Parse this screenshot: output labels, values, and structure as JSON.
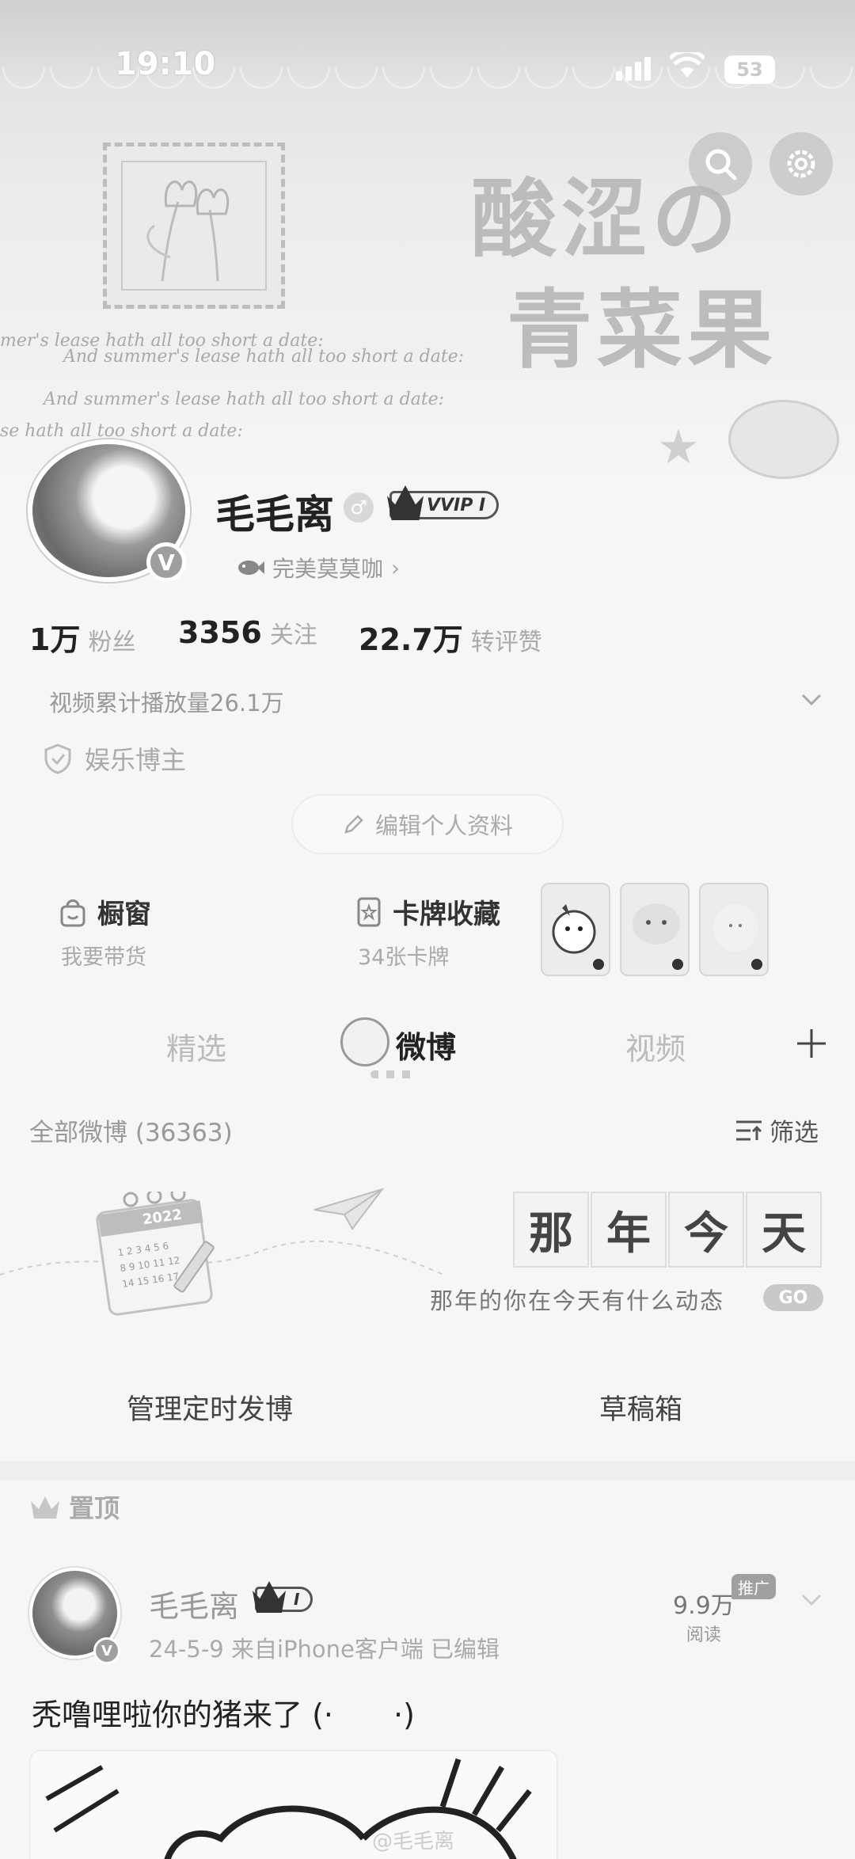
{
  "status_bar": {
    "time": "19:10",
    "battery": "53"
  },
  "banner": {
    "title_line1": "酸涩の",
    "title_line2": "青菜果",
    "script_line1": "mer's lease hath all too short a date:",
    "script_line2": "And summer's lease hath all too short a date:",
    "script_line3": "And summer's lease hath all too short a date:",
    "script_line4": "se hath all too short a date:"
  },
  "profile": {
    "username": "毛毛离",
    "gender": "♂",
    "vip_label": "VVIP Ⅰ",
    "verified_mark": "V",
    "fan_club": "完美莫莫咖",
    "stats": [
      {
        "value": "1万",
        "label": "粉丝"
      },
      {
        "value": "3356",
        "label": "关注"
      },
      {
        "value": "22.7万",
        "label": "转评赞"
      }
    ],
    "play_count": "视频累计播放量26.1万",
    "tag": "娱乐博主",
    "edit_button": "编辑个人资料"
  },
  "features": {
    "shop": {
      "title": "橱窗",
      "subtitle": "我要带货"
    },
    "cards": {
      "title": "卡牌收藏",
      "subtitle": "34张卡牌"
    }
  },
  "tabs": [
    {
      "label": "精选"
    },
    {
      "label": "微博"
    },
    {
      "label": "视频"
    }
  ],
  "feed": {
    "all_weibo": "全部微博 (36363)",
    "filter": "筛选"
  },
  "memories": {
    "chars": [
      "那",
      "年",
      "今",
      "天"
    ],
    "subtitle": "那年的你在今天有什么动态",
    "go": "GO",
    "calendar_year": "2022"
  },
  "actions": {
    "scheduled": "管理定时发博",
    "drafts": "草稿箱"
  },
  "pinned": {
    "label": "置顶"
  },
  "post": {
    "author": "毛毛离",
    "vip_level": "Ⅰ",
    "meta": "24-5-9  来自iPhone客户端  已编辑",
    "reads_count": "9.9万",
    "reads_label": "阅读",
    "promo": "推广",
    "text": "秃噜哩啦你的猪来了 (·　　·)",
    "watermark": "@毛毛离"
  },
  "colors": {
    "page_bg": "#f6f6f6",
    "text_primary": "#222222",
    "text_muted": "#aaaaaa"
  },
  "icons": [
    "search-icon",
    "settings-icon",
    "fish-icon",
    "shield-icon",
    "pencil-icon",
    "bag-icon",
    "card-icon",
    "plus-icon",
    "filter-icon",
    "crown-icon",
    "chevron-down-icon",
    "paper-plane-icon",
    "calendar-icon"
  ]
}
